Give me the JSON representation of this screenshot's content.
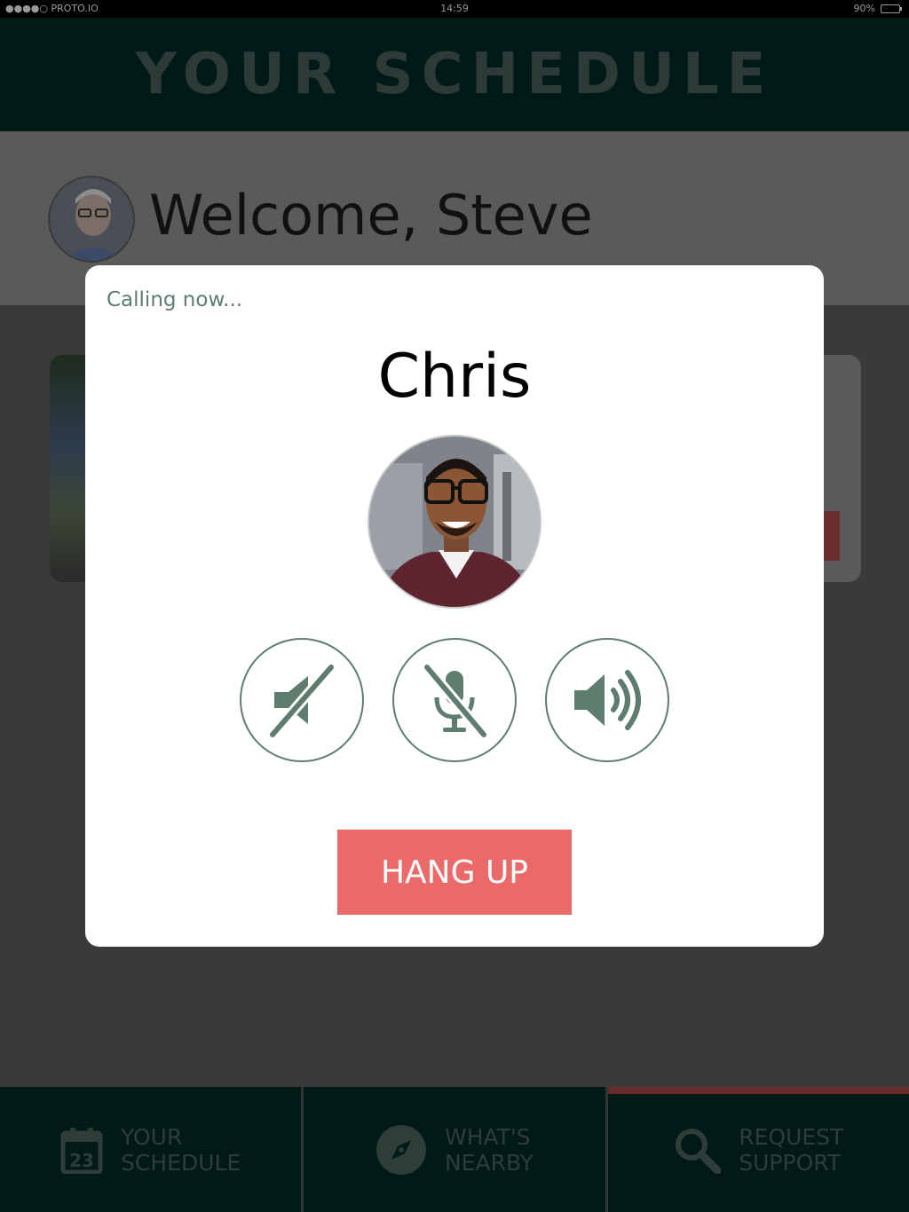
{
  "status_bar": {
    "carrier": "●●●●○ PROTO.IO",
    "time": "14:59",
    "battery": "90%",
    "battery_level": 0.9
  },
  "header": {
    "title": "YOUR SCHEDULE"
  },
  "welcome": {
    "text": "Welcome, Steve",
    "avatar_icon": "user-avatar"
  },
  "call_modal": {
    "status": "Calling now...",
    "callee_name": "Chris",
    "controls": [
      {
        "name": "speaker-mute-icon"
      },
      {
        "name": "mic-mute-icon"
      },
      {
        "name": "speaker-icon"
      }
    ],
    "hangup_label": "HANG UP"
  },
  "bottom_nav": {
    "items": [
      {
        "line1": "YOUR",
        "line2": "SCHEDULE",
        "icon": "calendar-icon",
        "icon_text": "23"
      },
      {
        "line1": "WHAT'S",
        "line2": "NEARBY",
        "icon": "compass-icon"
      },
      {
        "line1": "REQUEST",
        "line2": "SUPPORT",
        "icon": "search-icon",
        "active": true
      }
    ]
  },
  "colors": {
    "accent_green": "#5e7d6f",
    "hangup_red": "#ea6a6a",
    "nav_bg": "#021a15"
  }
}
